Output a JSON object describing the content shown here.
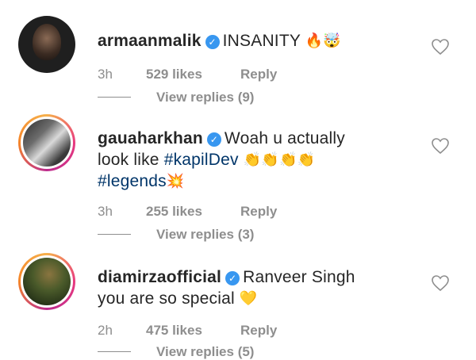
{
  "comments": [
    {
      "username": "armaanmalik",
      "text_parts": [
        "INSANITY"
      ],
      "emojis": [
        "🔥",
        "🤯"
      ],
      "time": "3h",
      "likes": "529 likes",
      "reply": "Reply",
      "view_replies": "View replies (9)"
    },
    {
      "username": "gauaharkhan",
      "text_line1": "Woah u actually",
      "text_line2_pre": "look like",
      "hashtag1": "#kapilDev",
      "hashtag2": "#legends",
      "emojis_line2": [
        "👏",
        "👏",
        "👏",
        "👏"
      ],
      "emoji_line3": "💥",
      "time": "3h",
      "likes": "255 likes",
      "reply": "Reply",
      "view_replies": "View replies (3)"
    },
    {
      "username": "diamirzaofficial",
      "text_line1": "Ranveer Singh",
      "text_line2": "you are so special",
      "emoji": "💛",
      "time": "2h",
      "likes": "475 likes",
      "reply": "Reply",
      "view_replies": "View replies (5)"
    }
  ],
  "icons": {
    "verified": "verified-badge-icon",
    "like": "heart-outline-icon"
  },
  "colors": {
    "verified": "#3897f0",
    "hashtag": "#003569",
    "meta": "#8e8e8e"
  }
}
